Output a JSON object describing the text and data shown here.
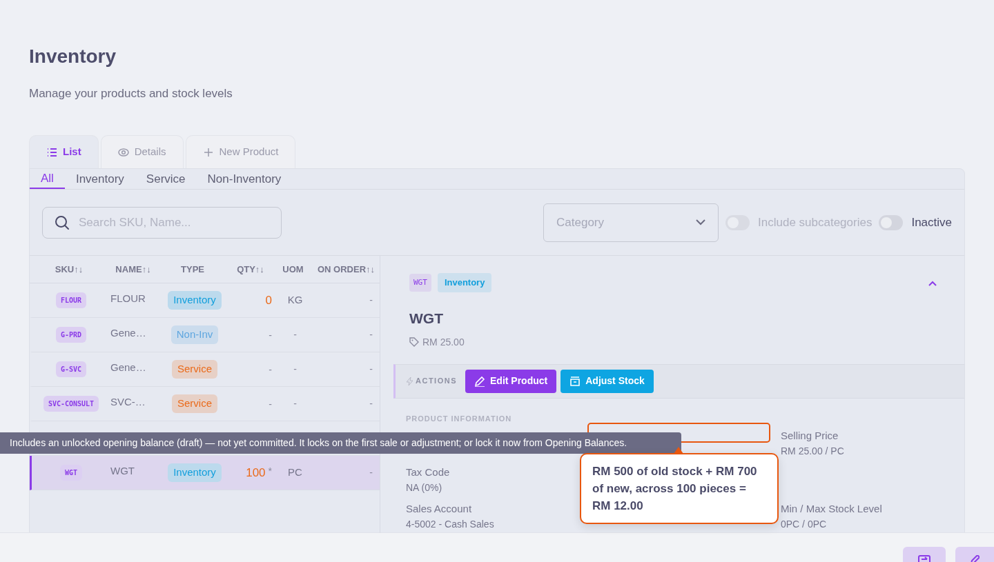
{
  "page": {
    "title": "Inventory",
    "subtitle": "Manage your products and stock levels"
  },
  "view_tabs": [
    {
      "label": "List",
      "selected": true
    },
    {
      "label": "Details",
      "selected": false
    },
    {
      "label": "New Product",
      "selected": false
    }
  ],
  "type_tabs": [
    {
      "label": "All",
      "selected": true
    },
    {
      "label": "Inventory",
      "selected": false
    },
    {
      "label": "Service",
      "selected": false
    },
    {
      "label": "Non-Inventory",
      "selected": false
    }
  ],
  "search": {
    "placeholder": "Search SKU, Name..."
  },
  "category": {
    "placeholder": "Category"
  },
  "toggles": [
    {
      "label": "Include subcategories",
      "on": false,
      "disabled": true
    },
    {
      "label": "Inactive",
      "on": false,
      "disabled": false
    }
  ],
  "table": {
    "columns": [
      "SKU↑↓",
      "NAME↑↓",
      "TYPE",
      "QTY↑↓",
      "UOM",
      "ON ORDER↑↓"
    ],
    "rows": [
      {
        "kind": "item",
        "sku": "FLOUR",
        "name": "FLOUR",
        "type": {
          "label": "Inventory",
          "color": "#129fdc"
        },
        "qty": {
          "text": "0",
          "kind": "stock"
        },
        "uom": "KG",
        "on_order": "-",
        "selected": false
      },
      {
        "kind": "item",
        "sku": "G-PRD",
        "name": "Gene…",
        "type": {
          "label": "Non-Inv",
          "color": "#5ea6df"
        },
        "qty": {
          "text": "-",
          "kind": "none"
        },
        "uom": "-",
        "on_order": "-",
        "selected": false
      },
      {
        "kind": "item",
        "sku": "G-SVC",
        "name": "Gene…",
        "type": {
          "label": "Service",
          "color": "#ea6a1a"
        },
        "qty": {
          "text": "-",
          "kind": "none"
        },
        "uom": "-",
        "on_order": "-",
        "selected": false
      },
      {
        "kind": "item",
        "sku": "SVC-CONSULT",
        "name": "SVC-…",
        "type": {
          "label": "Service",
          "color": "#ea6a1a"
        },
        "qty": {
          "text": "-",
          "kind": "none"
        },
        "uom": "-",
        "on_order": "-",
        "selected": false
      },
      {
        "kind": "covered"
      },
      {
        "kind": "item",
        "sku": "WGT",
        "name": "WGT",
        "type": {
          "label": "Inventory",
          "color": "#129fdc"
        },
        "qty": {
          "text": "100",
          "kind": "stock",
          "mark": "*"
        },
        "uom": "PC",
        "on_order": "-",
        "selected": true
      }
    ]
  },
  "detail": {
    "sku": "WGT",
    "type": "Inventory",
    "name": "WGT",
    "price": "RM 25.00",
    "actions_label": "ACTIONS",
    "buttons": [
      {
        "label": "Edit Product",
        "kind": "edit"
      },
      {
        "label": "Adjust Stock",
        "kind": "stock"
      }
    ],
    "section_title": "PRODUCT INFORMATION",
    "fields": [
      {
        "kind": "blank"
      },
      {
        "kind": "blank"
      },
      {
        "kind": "field",
        "label": "Selling Price",
        "value": "RM 25.00 / PC"
      },
      {
        "kind": "field",
        "label": "Tax Code",
        "value": "NA (0%)"
      },
      {
        "kind": "blank"
      },
      {
        "kind": "blank"
      },
      {
        "kind": "field",
        "label": "Sales Account",
        "value": "4-5002 - Cash Sales"
      },
      {
        "kind": "blank"
      },
      {
        "kind": "field",
        "label": "Min / Max Stock Level",
        "value": "0PC / 0PC"
      }
    ]
  },
  "tooltip": "Includes an unlocked opening balance (draft) — not yet committed. It locks on the first sale or adjustment; or lock it now from Opening Balances.",
  "popover": "RM 500 of old stock + RM 700 of new, across 100 pieces = RM 12.00"
}
